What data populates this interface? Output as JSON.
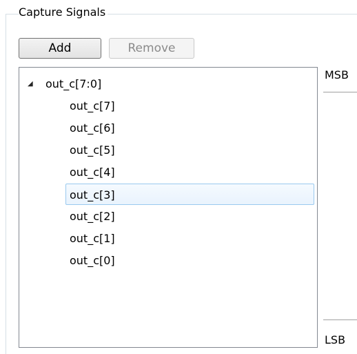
{
  "group": {
    "title": "Capture Signals"
  },
  "buttons": {
    "add_label": "Add",
    "remove_label": "Remove"
  },
  "tree": {
    "parent": {
      "expander": "◢",
      "label": "out_c[7:0]"
    },
    "children": [
      {
        "label": "out_c[7]",
        "selected": false
      },
      {
        "label": "out_c[6]",
        "selected": false
      },
      {
        "label": "out_c[5]",
        "selected": false
      },
      {
        "label": "out_c[4]",
        "selected": false
      },
      {
        "label": "out_c[3]",
        "selected": true
      },
      {
        "label": "out_c[2]",
        "selected": false
      },
      {
        "label": "out_c[1]",
        "selected": false
      },
      {
        "label": "out_c[0]",
        "selected": false
      }
    ]
  },
  "order": {
    "top_label": "MSB",
    "bottom_label": "LSB"
  },
  "colors": {
    "selection_border": "#99c9ef",
    "selection_fill": "#e9f3fd",
    "disabled_text": "#8a8a8a"
  }
}
